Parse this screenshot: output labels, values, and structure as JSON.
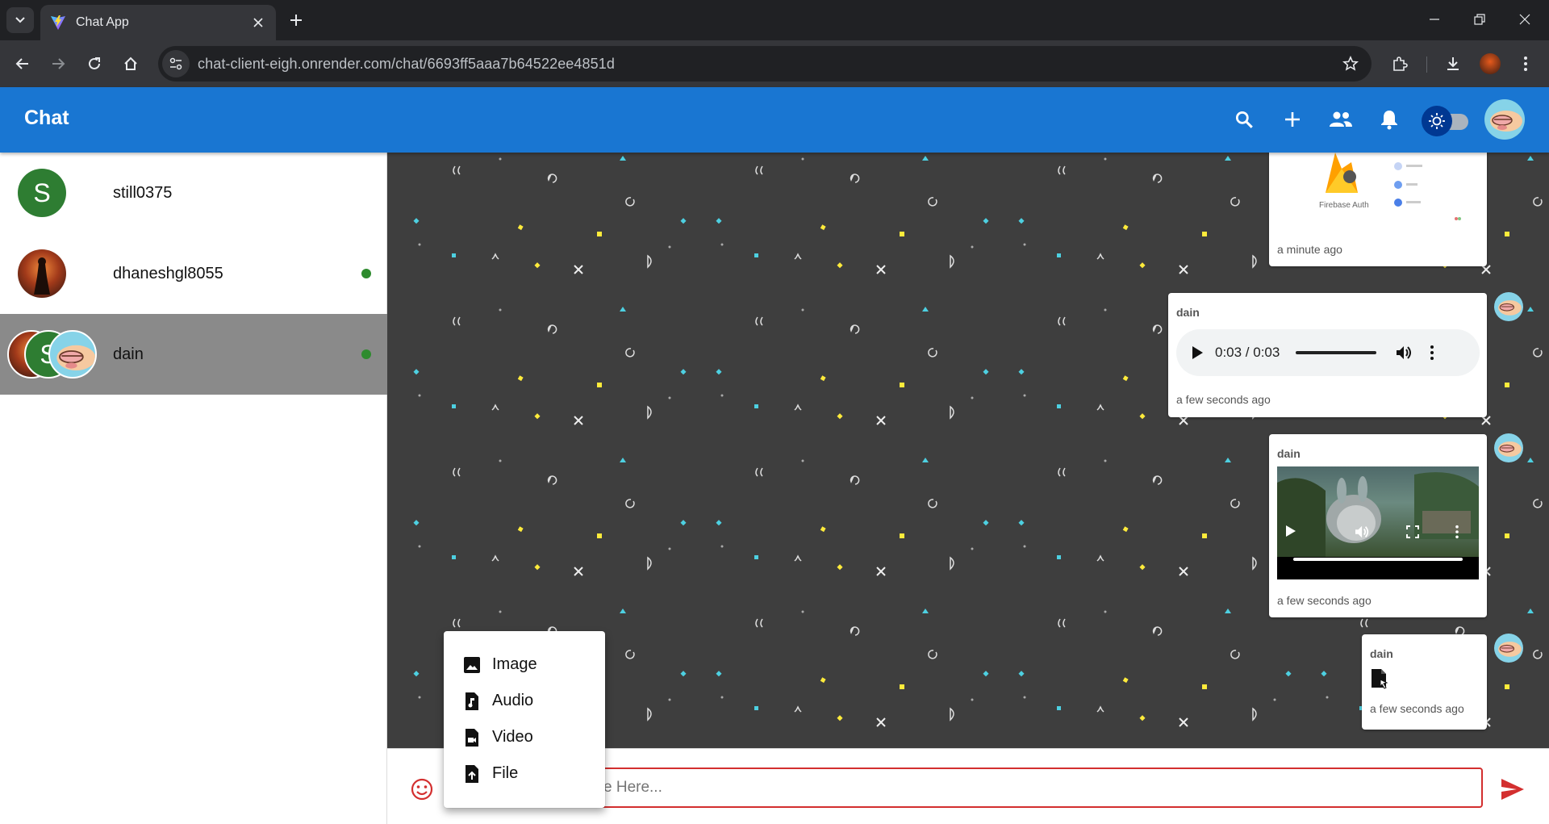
{
  "browser": {
    "tab_title": "Chat App",
    "url": "chat-client-eigh.onrender.com/chat/6693ff5aaa7b64522ee4851d"
  },
  "app": {
    "title": "Chat",
    "accent_color": "#1976d2"
  },
  "conversations": [
    {
      "name": "still0375",
      "avatar_letter": "S",
      "online": false,
      "active": false
    },
    {
      "name": "dhaneshgl8055",
      "avatar_letter": "",
      "online": true,
      "active": false
    },
    {
      "name": "dain",
      "avatar_letter": "S",
      "online": true,
      "active": true
    }
  ],
  "messages": [
    {
      "type": "image",
      "sender": "",
      "image_caption": "Firebase Auth",
      "time": "a minute ago"
    },
    {
      "type": "audio",
      "sender": "dain",
      "audio_time": "0:03 / 0:03",
      "time": "a few seconds ago"
    },
    {
      "type": "video",
      "sender": "dain",
      "time": "a few seconds ago"
    },
    {
      "type": "file",
      "sender": "dain",
      "time": "a few seconds ago"
    }
  ],
  "composer": {
    "placeholder": "Type Here...",
    "visible_placeholder_fragment": "e Here..."
  },
  "attach_menu": {
    "items": [
      {
        "label": "Image",
        "icon": "image-icon"
      },
      {
        "label": "Audio",
        "icon": "audio-file-icon"
      },
      {
        "label": "Video",
        "icon": "video-file-icon"
      },
      {
        "label": "File",
        "icon": "upload-file-icon"
      }
    ]
  },
  "colors": {
    "online": "#2e8b2e",
    "chat_background": "#3e3e3e",
    "input_border": "#d32f2f",
    "active_conversation": "#8a8a8a"
  }
}
